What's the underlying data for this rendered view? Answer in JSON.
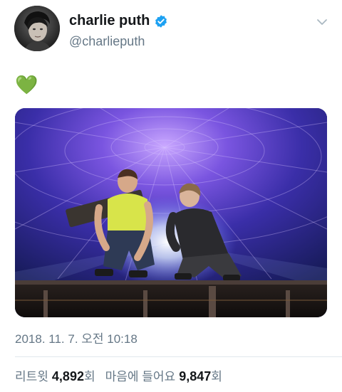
{
  "user": {
    "display_name": "charlie puth",
    "handle": "@charlieputh",
    "verified": true,
    "avatar_icon": "profile-photo"
  },
  "tweet": {
    "text": "💚",
    "media_description_icon": "concert-photo",
    "timestamp": "2018. 11. 7. 오전 10:18"
  },
  "stats": {
    "retweets_label": "리트윗",
    "retweets_count": "4,892",
    "retweets_suffix": "회",
    "likes_label": "마음에 들어요",
    "likes_count": "9,847",
    "likes_suffix": "회"
  },
  "colors": {
    "verified_blue": "#1da1f2",
    "secondary_text": "#657786",
    "primary_text": "#14171a",
    "divider": "#e1e8ed"
  },
  "icons": {
    "verified": "verified-badge-icon",
    "menu": "chevron-down-icon"
  }
}
